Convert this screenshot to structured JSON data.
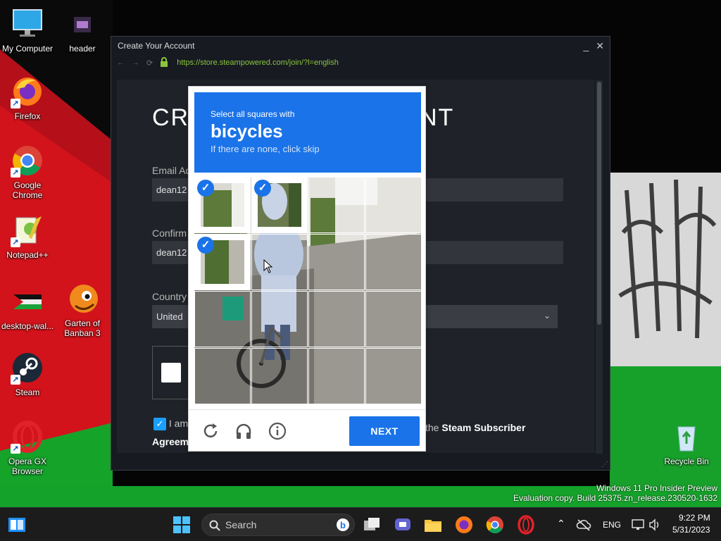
{
  "desktop": {
    "icons": [
      {
        "label": "My Computer"
      },
      {
        "label": "header"
      },
      {
        "label": "Firefox"
      },
      {
        "label": "Google Chrome"
      },
      {
        "label": "Notepad++"
      },
      {
        "label": "desktop-wal..."
      },
      {
        "label": "Garten of Banban 3"
      },
      {
        "label": "Steam"
      },
      {
        "label": "Opera GX Browser"
      },
      {
        "label": "Recycle Bin"
      }
    ]
  },
  "window": {
    "title": "Create Your Account",
    "url": "https://store.steampowered.com/join/?l=english",
    "page": {
      "heading_left": "CRE",
      "heading_right": "NT",
      "email_label": "Email Ad",
      "email_value": "dean12",
      "confirm_label": "Confirm",
      "confirm_value": "dean12",
      "country_label": "Country",
      "country_value": "United",
      "agree_prefix": "I am",
      "agree_middle": "the",
      "agree_link": "Steam Subscriber",
      "agree_line2": "Agreem"
    }
  },
  "captcha": {
    "instruction": "Select all squares with",
    "target": "bicycles",
    "hint": "If there are none, click skip",
    "selected_tiles": [
      0,
      1,
      4
    ],
    "next_label": "NEXT",
    "icons": [
      "reload-icon",
      "audio-icon",
      "info-icon"
    ]
  },
  "watermark": {
    "line1": "Windows 11 Pro Insider Preview",
    "line2": "Evaluation copy. Build 25375.zn_release.230520-1632"
  },
  "taskbar": {
    "search_placeholder": "Search",
    "language": "ENG",
    "time": "9:22 PM",
    "date": "5/31/2023"
  },
  "colors": {
    "captcha_blue": "#1a73e8",
    "steam_bg": "#1f2329",
    "url_green": "#8bc53f"
  }
}
